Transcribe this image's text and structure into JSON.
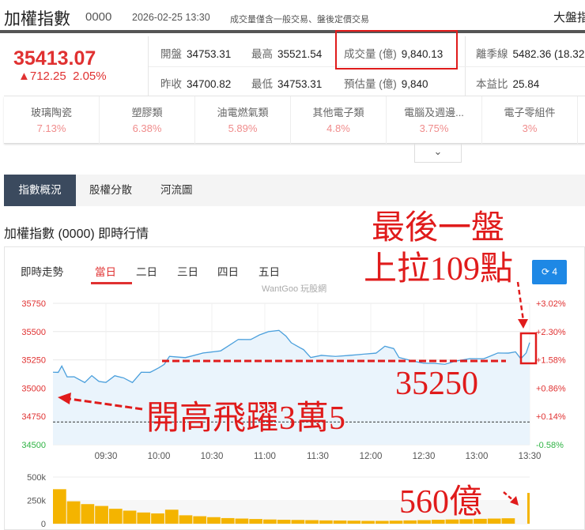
{
  "header": {
    "title": "加權指數",
    "code": "0000",
    "datetime": "2026-02-25 13:30",
    "note": "成交量僅含一般交易、盤後定價交易",
    "right": "大盤指"
  },
  "quote": {
    "price": "35413.07",
    "change": "▲712.25",
    "change_pct": "2.05%",
    "stats": [
      {
        "label": "開盤",
        "value": "34753.31"
      },
      {
        "label": "最高",
        "value": "35521.54"
      },
      {
        "label": "成交量 (億)",
        "value": "9,840.13"
      },
      {
        "label": "離季線",
        "value": "5482.36 (18.32"
      },
      {
        "label": "昨收",
        "value": "34700.82"
      },
      {
        "label": "最低",
        "value": "34753.31"
      },
      {
        "label": "預估量 (億)",
        "value": "9,840"
      },
      {
        "label": "本益比",
        "value": "25.84"
      }
    ]
  },
  "sectors": [
    {
      "name": "玻璃陶瓷",
      "pct": "7.13%"
    },
    {
      "name": "塑膠類",
      "pct": "6.38%"
    },
    {
      "name": "油電燃氣類",
      "pct": "5.89%"
    },
    {
      "name": "其他電子類",
      "pct": "4.8%"
    },
    {
      "name": "電腦及週邊...",
      "pct": "3.75%"
    },
    {
      "name": "電子零組件",
      "pct": "3%"
    }
  ],
  "expand_icon": "chevron-down-icon",
  "expand_glyph": "⌄",
  "tabs": [
    "指數概況",
    "股權分散",
    "河流圖"
  ],
  "section_title": "加權指數 (0000) 即時行情",
  "chart_card": {
    "title": "即時走勢",
    "ranges": [
      "當日",
      "二日",
      "三日",
      "四日",
      "五日"
    ],
    "active_range": "當日",
    "refresh_label": "⟳ 4",
    "watermark": "WantGoo 玩股網"
  },
  "annotations": {
    "top1": "最後一盤",
    "top2": "上拉109點",
    "level": "35250",
    "open": "開高飛躍3萬5",
    "volume": "560億"
  },
  "colors": {
    "up": "#e03131",
    "down": "#2fb344",
    "line": "#4a9fdc",
    "volume": "#f4b400",
    "annotation": "#e01b1b"
  },
  "chart_data": [
    {
      "type": "area",
      "title": "即時走勢",
      "y_left_ticks": [
        "35750",
        "35500",
        "35250",
        "35000",
        "34750",
        "34500"
      ],
      "y_right_ticks": [
        "+3.02%",
        "+2.30%",
        "+1.58%",
        "+0.86%",
        "+0.14%",
        "-0.58%"
      ],
      "ylim": [
        34500,
        35750
      ],
      "x_ticks": [
        "09:30",
        "10:00",
        "10:30",
        "11:00",
        "11:30",
        "12:00",
        "12:30",
        "13:00",
        "13:30"
      ],
      "xlim_minutes": [
        0,
        270
      ],
      "prev_close": 34700.82,
      "points": [
        [
          0,
          35130
        ],
        [
          3,
          35150
        ],
        [
          5,
          35185
        ],
        [
          8,
          35110
        ],
        [
          12,
          35090
        ],
        [
          18,
          35060
        ],
        [
          22,
          35100
        ],
        [
          26,
          35070
        ],
        [
          30,
          35040
        ],
        [
          35,
          35120
        ],
        [
          40,
          35080
        ],
        [
          45,
          35060
        ],
        [
          50,
          35130
        ],
        [
          55,
          35150
        ],
        [
          60,
          35170
        ],
        [
          63,
          35220
        ],
        [
          66,
          35270
        ],
        [
          75,
          35280
        ],
        [
          85,
          35300
        ],
        [
          95,
          35340
        ],
        [
          105,
          35420
        ],
        [
          112,
          35440
        ],
        [
          117,
          35460
        ],
        [
          122,
          35510
        ],
        [
          128,
          35500
        ],
        [
          132,
          35470
        ],
        [
          135,
          35390
        ],
        [
          142,
          35350
        ],
        [
          146,
          35260
        ],
        [
          152,
          35300
        ],
        [
          160,
          35270
        ],
        [
          168,
          35300
        ],
        [
          176,
          35290
        ],
        [
          183,
          35320
        ],
        [
          188,
          35360
        ],
        [
          193,
          35360
        ],
        [
          196,
          35260
        ],
        [
          204,
          35250
        ],
        [
          210,
          35210
        ],
        [
          216,
          35230
        ],
        [
          222,
          35200
        ],
        [
          228,
          35250
        ],
        [
          236,
          35250
        ],
        [
          244,
          35270
        ],
        [
          252,
          35300
        ],
        [
          258,
          35320
        ],
        [
          262,
          35310
        ],
        [
          265,
          35270
        ],
        [
          268,
          35300
        ],
        [
          270,
          35413
        ]
      ]
    },
    {
      "type": "bar",
      "y_ticks": [
        "500k",
        "250k",
        "0"
      ],
      "ylim": [
        0,
        500000
      ],
      "values": [
        370000,
        240000,
        210000,
        190000,
        160000,
        140000,
        120000,
        110000,
        150000,
        90000,
        80000,
        70000,
        60000,
        55000,
        50000,
        45000,
        42000,
        40000,
        38000,
        35000,
        34000,
        32000,
        30000,
        30000,
        32000,
        35000,
        38000,
        42000,
        45000,
        48000,
        52000,
        55000,
        58000,
        330000
      ]
    }
  ]
}
